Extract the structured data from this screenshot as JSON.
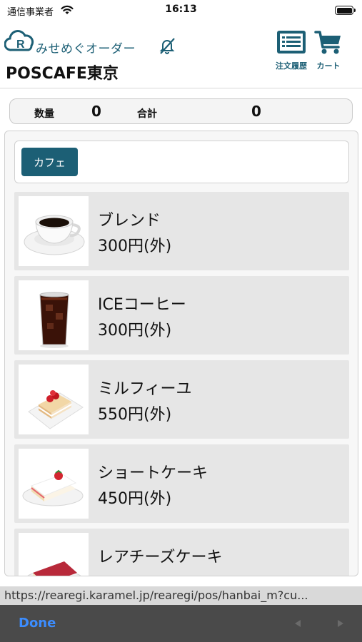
{
  "status_bar": {
    "carrier": "通信事業者",
    "time": "16:13"
  },
  "header": {
    "app_name": "みせめぐオーダー",
    "shop_name": "POSCAFE東京",
    "history_label": "注文履歴",
    "cart_label": "カート",
    "brand_color": "#1c5f75"
  },
  "summary": {
    "qty_label": "数量",
    "qty_value": "0",
    "total_label": "合計",
    "total_value": "0"
  },
  "categories": [
    {
      "label": "カフェ"
    }
  ],
  "items": [
    {
      "name": "ブレンド",
      "price": "300円(外)",
      "image": "coffee-cup-image"
    },
    {
      "name": "ICEコーヒー",
      "price": "300円(外)",
      "image": "iced-coffee-image"
    },
    {
      "name": "ミルフィーユ",
      "price": "550円(外)",
      "image": "millefeuille-image"
    },
    {
      "name": "ショートケーキ",
      "price": "450円(外)",
      "image": "shortcake-image"
    },
    {
      "name": "レアチーズケーキ",
      "price": "",
      "image": "rare-cheesecake-image"
    }
  ],
  "browser": {
    "url": "https://rearegi.karamel.jp/rearegi/pos/hanbai_m?cu...",
    "done_label": "Done"
  }
}
